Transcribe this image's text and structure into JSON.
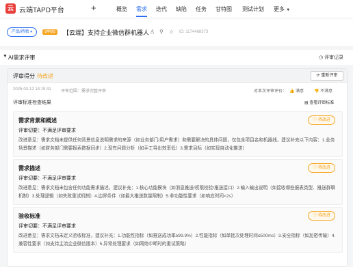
{
  "topbar": {
    "logo_text": "云",
    "app_name": "云端TAPD平台",
    "add_icon": "+",
    "nav": [
      "概览",
      "需求",
      "迭代",
      "缺陷",
      "任务",
      "甘特图",
      "测试计划",
      "更多"
    ],
    "active_nav": "需求"
  },
  "header": {
    "product_select": "产品/待验 ▾",
    "badge": "WPMS",
    "title": "【云端】支持企业微信群机器人",
    "id": "ID: 1174468373"
  },
  "section": {
    "title": "AI需求评审",
    "history_button": "评审记录"
  },
  "review": {
    "score_label": "评审得分",
    "score_value": "待改进",
    "reevaluate_button": "重新评审",
    "time": "2025-03-12 14:19:41",
    "review_type": "评审范围：需求完整评审",
    "target_label": "对本次评审评价：",
    "like": "满意",
    "dislike": "不满意",
    "results_label": "评审标准检查结果",
    "view_standard": "查看评审标准",
    "items": [
      {
        "title": "需求背景和概述",
        "status": "待改进",
        "verdict": "评审切要：不满足评审要求",
        "suggestion": "改进意见：需求文档未提供任何背景信息说明需求的来源（如业务部门/用户需求）和需要解决的具体问题，仅包含项目名和机器线，建议补充以下内容：1.业务场景描述（如财务部门需要报表数据同步）2.现有问题分析（如手工导出效率低）3.需求目标（如实现自动化推送）"
      },
      {
        "title": "需求描述",
        "status": "待改进",
        "verdict": "评审切要：不满足评审要求",
        "suggestion": "改进意见：需求文档未包含任何功能需求描述，建议补充：1.核心功能模块（如消息推送/权限校验/推送接口）2.输入输出说明（如接收哪些报表类型、推送群聊机制）3.处理逻辑（如失败重试机制）4.边界条件（如最大推送数量限制）5.非功能性要求（如响应时间<2s）"
      },
      {
        "title": "验收标准",
        "status": "待改进",
        "verdict": "评审切要：不满足评审要求",
        "suggestion": "改进意见：需求文档未定义验收标准，建议补充：1.功能性指标（如推送成功率≥99.9%）2.性能指标（如单批次处理时间≤500ms）3.安全指标（如加密传输）4.兼容性要求（如支持主流企业微信版本）5.异常处理要求（如网络中断时的重试策略）"
      }
    ]
  }
}
